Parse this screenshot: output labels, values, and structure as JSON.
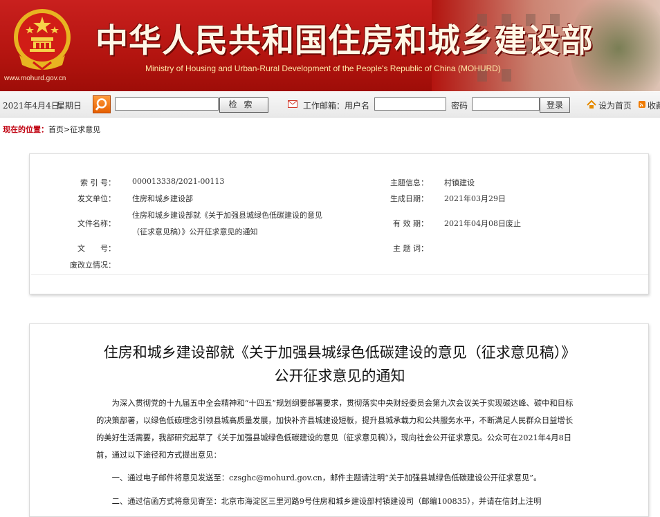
{
  "header": {
    "title": "中华人民共和国住房和城乡建设部",
    "subtitle": "Ministry of Housing and Urban-Rural Development of the People's Republic of China (MOHURD)",
    "url": "www.mohurd.gov.cn"
  },
  "toolbar": {
    "date": "2021年4月4日",
    "weekday": "星期日",
    "search_value": "",
    "search_button": "检索",
    "mail_label": "工作邮箱：用户名",
    "username_value": "",
    "password_label": "密码",
    "password_value": "",
    "login_button": "登录",
    "home_link": "设为首页",
    "favorite_link": "收藏"
  },
  "breadcrumb": {
    "label": "现在的位置：",
    "home": "首页",
    "separator": ">",
    "current": "征求意见"
  },
  "info": {
    "index_label": "索 引 号：",
    "index_value": "000013338/2021-00113",
    "issuer_label": "发文单位：",
    "issuer_value": "住房和城乡建设部",
    "filename_label": "文件名称：",
    "filename_value_line1": "住房和城乡建设部就《关于加强县城绿色低碳建设的意见",
    "filename_value_line2": "（征求意见稿）》公开征求意见的通知",
    "docno_label": "文　　号：",
    "status_label": "废改立情况：",
    "topic_label": "主题信息：",
    "topic_value": "村镇建设",
    "created_label": "生成日期：",
    "created_value": "2021年03月29日",
    "valid_label": "有 效 期：",
    "valid_value": "2021年04月08日废止",
    "subject_label": "主 题 词："
  },
  "article": {
    "title_line1": "住房和城乡建设部就《关于加强县城绿色低碳建设的意见（征求意见稿）》",
    "title_line2": "公开征求意见的通知",
    "para1": "为深入贯彻党的十九届五中全会精神和“十四五”规划纲要部署要求，贯彻落实中央财经委员会第九次会议关于实现碳达峰、碳中和目标的决策部署，以绿色低碳理念引领县城高质量发展，加快补齐县城建设短板，提升县城承载力和公共服务水平，不断满足人民群众日益增长的美好生活需要，我部研究起草了《关于加强县城绿色低碳建设的意见（征求意见稿）》，现向社会公开征求意见。公众可在2021年4月8日前，通过以下途径和方式提出意见：",
    "para2": "一、通过电子邮件将意见发送至：czsghc@mohurd.gov.cn，邮件主题请注明“关于加强县城绿色低碳建设公开征求意见”。",
    "para3": "二、通过信函方式将意见寄至：北京市海淀区三里河路9号住房和城乡建设部村镇建设司（邮编100835），并请在信封上注明"
  },
  "colors": {
    "banner_red": "#b3140f",
    "breadcrumb_red": "#c0000f",
    "title_gold": "#fff7e6"
  }
}
